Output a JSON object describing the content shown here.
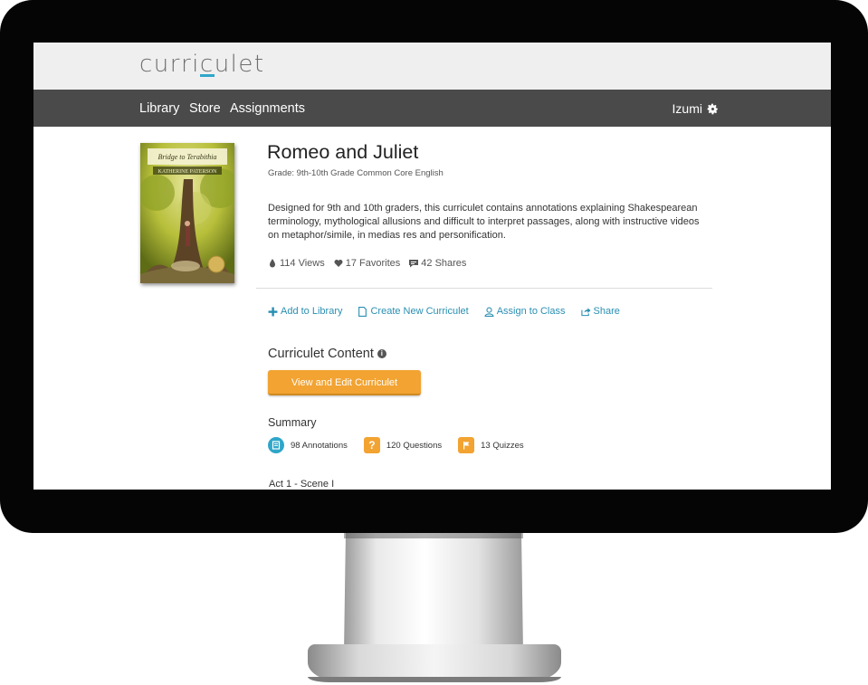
{
  "app": {
    "logo_text_a": "curri",
    "logo_text_b": "c",
    "logo_text_c": "ulet",
    "accent_color": "#2fa6c9"
  },
  "nav": {
    "items": [
      "Library",
      "Store",
      "Assignments"
    ],
    "user_name": "Izumi"
  },
  "book": {
    "cover_title": "Bridge to Terabithia",
    "cover_author": "KATHERINE PATERSON",
    "title": "Romeo and Juliet",
    "grade": "Grade: 9th-10th Grade Common Core English",
    "description": "Designed for 9th and 10th graders, this curriculet contains annotations explaining Shakespearean terminology, mythological allusions and difficult to interpret passages, along with instructive videos on metaphor/simile, in medias res and personification.",
    "views": "114 Views",
    "favorites": "17 Favorites",
    "shares": "42 Shares"
  },
  "actions": {
    "add": "Add to Library",
    "create": "Create New Curriculet",
    "assign": "Assign to Class",
    "share": "Share"
  },
  "content": {
    "section_title": "Curriculet Content",
    "button": "View and Edit Curriculet",
    "summary_title": "Summary",
    "annotations": "98 Annotations",
    "questions": "120 Questions",
    "quizzes": "13 Quizzes",
    "first_act": "Act 1 - Scene I"
  }
}
